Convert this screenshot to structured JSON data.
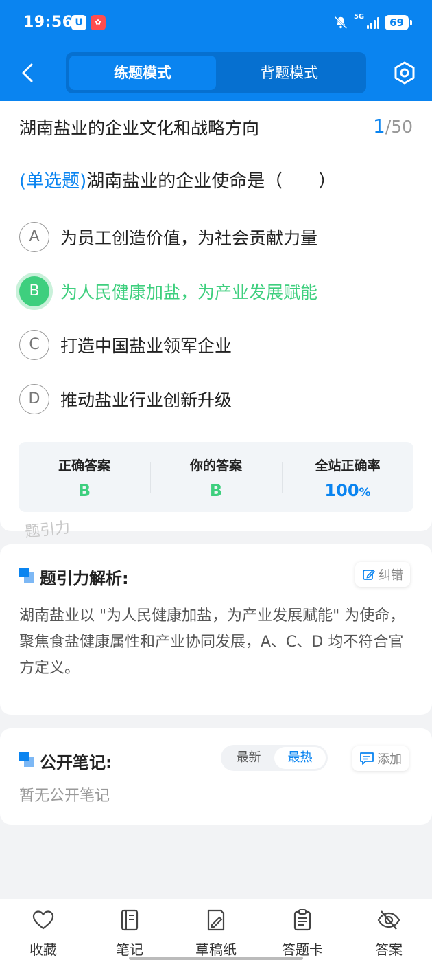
{
  "status": {
    "time": "19:56",
    "network": "5G",
    "battery": "69"
  },
  "header": {
    "tabs": [
      {
        "label": "练题模式",
        "active": true
      },
      {
        "label": "背题模式",
        "active": false
      }
    ]
  },
  "question": {
    "chapter": "湖南盐业的企业文化和战略方向",
    "current": "1",
    "total": "/50",
    "type_tag": "(单选题)",
    "stem": "湖南盐业的企业使命是（　　）",
    "options": [
      {
        "letter": "A",
        "text": "为员工创造价值，为社会贡献力量"
      },
      {
        "letter": "B",
        "text": "为人民健康加盐，为产业发展赋能"
      },
      {
        "letter": "C",
        "text": "打造中国盐业领军企业"
      },
      {
        "letter": "D",
        "text": "推动盐业行业创新升级"
      }
    ],
    "watermark": "题引力"
  },
  "result": {
    "correct_label": "正确答案",
    "correct_value": "B",
    "yours_label": "你的答案",
    "yours_value": "B",
    "rate_label": "全站正确率",
    "rate_value": "100",
    "rate_unit": "%"
  },
  "analysis": {
    "title": "题引力解析:",
    "correct_button": "纠错",
    "body": "湖南盐业以 \"为人民健康加盐，为产业发展赋能\" 为使命，聚焦食盐健康属性和产业协同发展，A、C、D 均不符合官方定义。"
  },
  "notes": {
    "title": "公开笔记:",
    "sort": [
      {
        "label": "最新",
        "active": false
      },
      {
        "label": "最热",
        "active": true
      }
    ],
    "add_button": "添加",
    "empty": "暂无公开笔记"
  },
  "bottom_bar": [
    {
      "label": "收藏",
      "icon": "heart-icon"
    },
    {
      "label": "笔记",
      "icon": "notebook-icon"
    },
    {
      "label": "草稿纸",
      "icon": "draft-pen-icon"
    },
    {
      "label": "答题卡",
      "icon": "answer-sheet-icon"
    },
    {
      "label": "答案",
      "icon": "eye-off-icon"
    }
  ],
  "colors": {
    "brand": "#0a84f0",
    "correct": "#3ecf7e"
  }
}
